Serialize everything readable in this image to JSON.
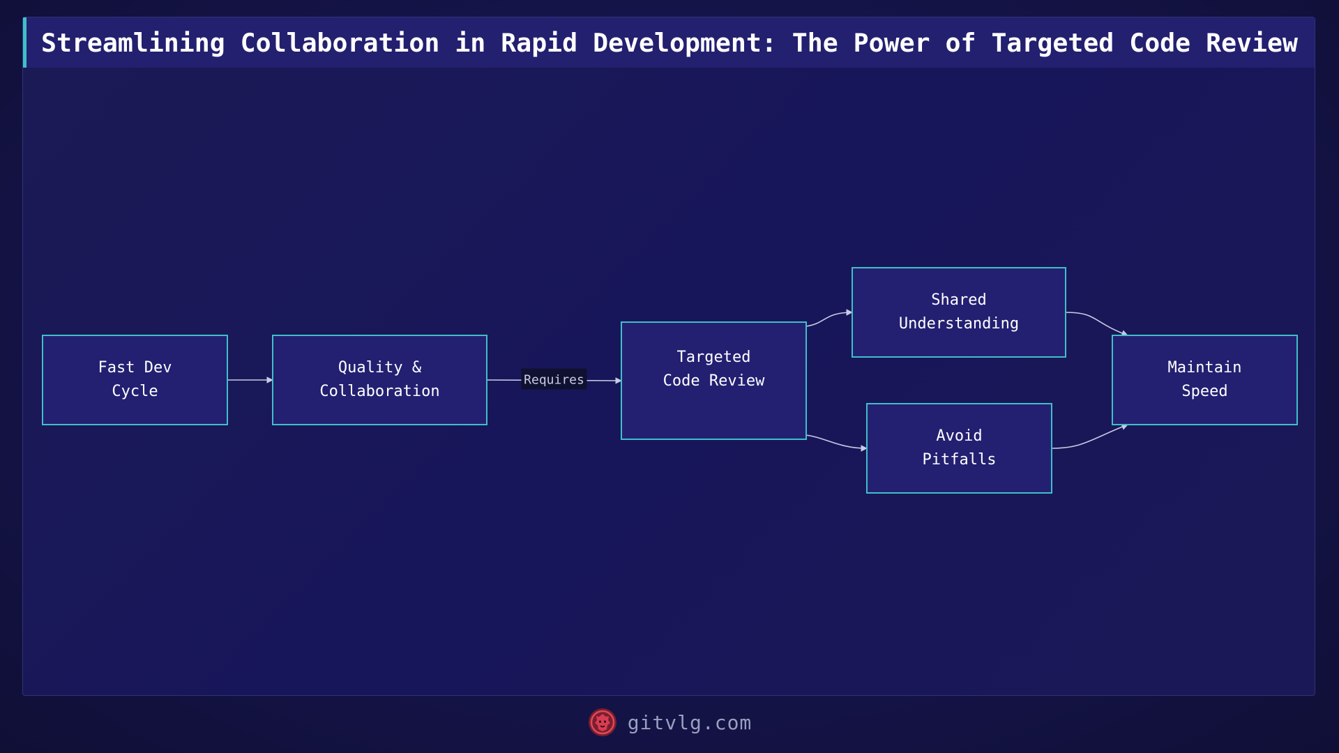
{
  "diagram": {
    "title": "Streamlining Collaboration in Rapid Development: The Power of Targeted Code Review",
    "nodes": [
      {
        "id": "fast-dev-cycle",
        "lines": [
          "Fast Dev",
          "Cycle"
        ]
      },
      {
        "id": "quality-collaboration",
        "lines": [
          "Quality &",
          "Collaboration"
        ]
      },
      {
        "id": "targeted-code-review",
        "lines": [
          "Targeted",
          "Code Review"
        ]
      },
      {
        "id": "shared-understanding",
        "lines": [
          "Shared",
          "Understanding"
        ]
      },
      {
        "id": "avoid-pitfalls",
        "lines": [
          "Avoid",
          "Pitfalls"
        ]
      },
      {
        "id": "maintain-speed",
        "lines": [
          "Maintain",
          "Speed"
        ]
      }
    ],
    "edges": [
      {
        "from": "fast-dev-cycle",
        "to": "quality-collaboration",
        "label": ""
      },
      {
        "from": "quality-collaboration",
        "to": "targeted-code-review",
        "label": "Requires"
      },
      {
        "from": "targeted-code-review",
        "to": "shared-understanding",
        "label": ""
      },
      {
        "from": "targeted-code-review",
        "to": "avoid-pitfalls",
        "label": ""
      },
      {
        "from": "shared-understanding",
        "to": "maintain-speed",
        "label": ""
      },
      {
        "from": "avoid-pitfalls",
        "to": "maintain-speed",
        "label": ""
      }
    ],
    "colors": {
      "node_fill": "#232072",
      "node_stroke": "#3fc0c8",
      "edge": "#c9cbe6",
      "accent": "#3fc0c8"
    }
  },
  "footer": {
    "site": "gitvlg.com",
    "logo_icon": "lion-head-icon"
  }
}
